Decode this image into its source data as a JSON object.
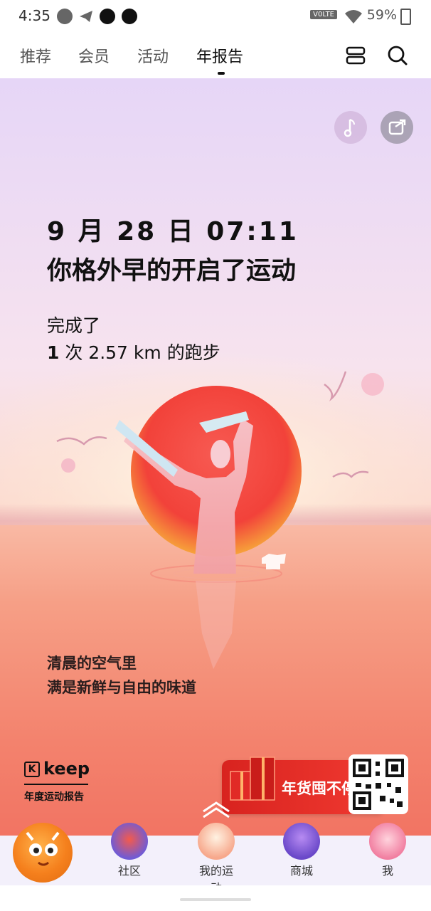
{
  "status_bar": {
    "time": "4:35",
    "network": "V0LTE",
    "battery": "59%"
  },
  "tabs": [
    {
      "label": "推荐"
    },
    {
      "label": "会员"
    },
    {
      "label": "活动"
    },
    {
      "label": "年报告"
    }
  ],
  "report": {
    "datetime": "9 月 28 日 07:11",
    "headline": "你格外早的开启了运动",
    "completed_label": "完成了",
    "count": "1",
    "count_unit": " 次 2.57 km 的跑步",
    "quote_line1": "清晨的空气里",
    "quote_line2": "满是新鲜与自由的味道"
  },
  "brand": {
    "name": "keep",
    "logo_letter": "K",
    "subtitle": "年度运动报告"
  },
  "promo": {
    "label": "年货囤不停!"
  },
  "bottom_nav": [
    {
      "label": "社区"
    },
    {
      "label": "我的运动"
    },
    {
      "label": "商城"
    },
    {
      "label": "我"
    }
  ],
  "colors": {
    "accent_red": "#f13a31",
    "sun": "#f34b3c",
    "bg_top": "#e6d6f7",
    "water": "#f47a68"
  }
}
